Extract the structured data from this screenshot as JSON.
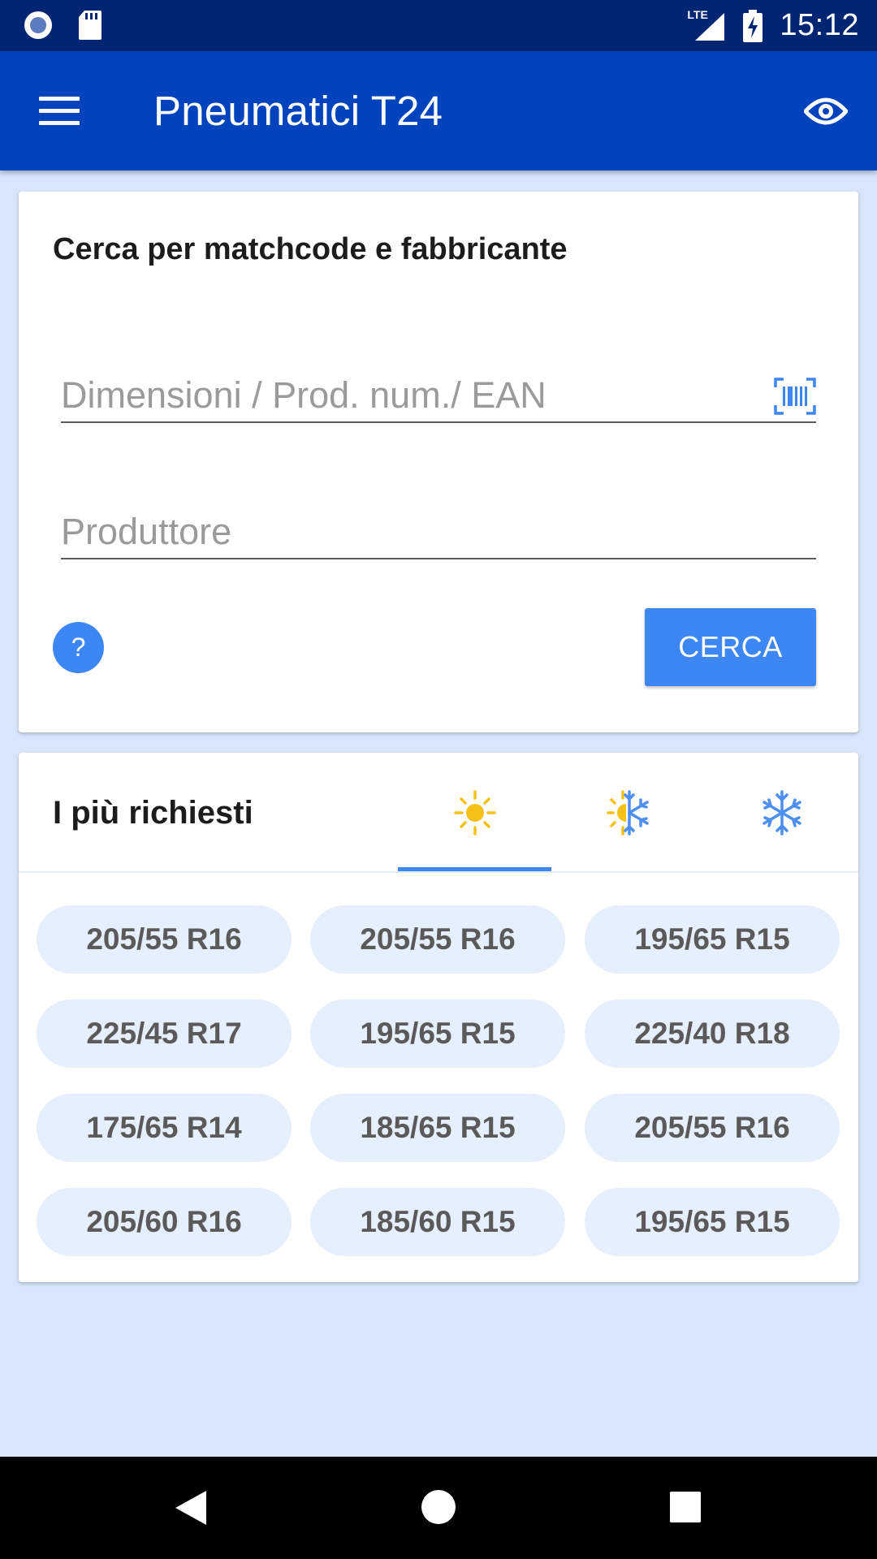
{
  "status_bar": {
    "time": "15:12",
    "network": "LTE"
  },
  "app_bar": {
    "title": "Pneumatici T24"
  },
  "search_card": {
    "heading": "Cerca per matchcode e fabbricante",
    "dimension_placeholder": "Dimensioni / Prod. num./ EAN",
    "manufacturer_placeholder": "Produttore",
    "help_label": "?",
    "search_label": "CERCA"
  },
  "popular_card": {
    "heading": "I più richiesti",
    "tabs": [
      {
        "icon": "sun-icon",
        "active": true
      },
      {
        "icon": "all-season-icon",
        "active": false
      },
      {
        "icon": "snowflake-icon",
        "active": false
      }
    ],
    "sizes": [
      "205/55 R16",
      "205/55 R16",
      "195/65 R15",
      "225/45 R17",
      "195/65 R15",
      "225/40 R18",
      "175/65 R14",
      "185/65 R15",
      "205/55 R16",
      "205/60 R16",
      "185/60 R15",
      "195/65 R15"
    ]
  },
  "colors": {
    "primary": "#0043bd",
    "status_bar": "#002573",
    "accent": "#3d87f5",
    "summer": "#f5c018",
    "winter": "#4d8ff0",
    "background": "#d8e6fc"
  }
}
